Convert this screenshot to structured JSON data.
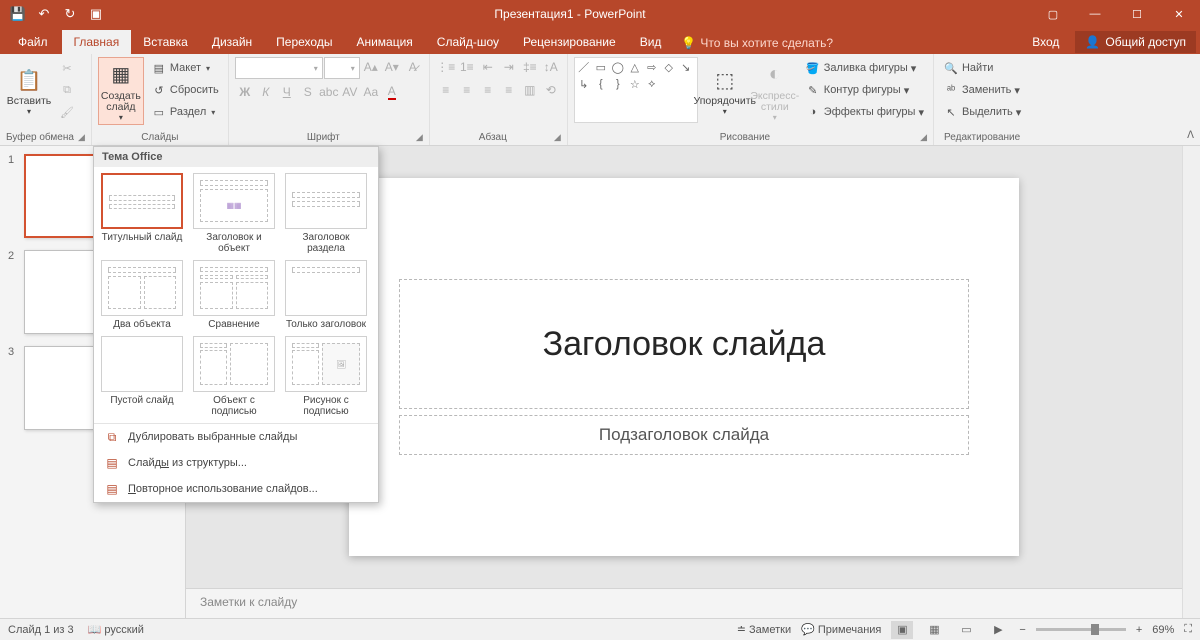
{
  "titlebar": {
    "title": "Презентация1 - PowerPoint"
  },
  "tabs": {
    "file": "Файл",
    "items": [
      "Главная",
      "Вставка",
      "Дизайн",
      "Переходы",
      "Анимация",
      "Слайд-шоу",
      "Рецензирование",
      "Вид"
    ],
    "active_index": 0,
    "tell_me": "Что вы хотите сделать?",
    "login": "Вход",
    "share": "Общий доступ"
  },
  "ribbon": {
    "clipboard": {
      "label": "Буфер обмена",
      "paste": "Вставить"
    },
    "slides": {
      "label": "Слайды",
      "new_slide": "Создать\nслайд",
      "layout": "Макет",
      "reset": "Сбросить",
      "section": "Раздел"
    },
    "font": {
      "label": "Шрифт"
    },
    "paragraph": {
      "label": "Абзац"
    },
    "drawing": {
      "label": "Рисование",
      "arrange": "Упорядочить",
      "quick_styles": "Экспресс-\nстили",
      "shape_fill": "Заливка фигуры",
      "shape_outline": "Контур фигуры",
      "shape_effects": "Эффекты фигуры"
    },
    "editing": {
      "label": "Редактирование",
      "find": "Найти",
      "replace": "Заменить",
      "select": "Выделить"
    }
  },
  "layout_popup": {
    "header": "Тема Office",
    "layouts": [
      "Титульный слайд",
      "Заголовок и объект",
      "Заголовок раздела",
      "Два объекта",
      "Сравнение",
      "Только заголовок",
      "Пустой слайд",
      "Объект с подписью",
      "Рисунок с подписью"
    ],
    "cmd_duplicate": "Дублировать выбранные слайды",
    "cmd_outline": "Слайды из структуры...",
    "cmd_reuse": "Повторное использование слайдов..."
  },
  "slide": {
    "title_placeholder": "Заголовок слайда",
    "subtitle_placeholder": "Подзаголовок слайда"
  },
  "notes": {
    "placeholder": "Заметки к слайду"
  },
  "status": {
    "slide_of": "Слайд 1 из 3",
    "language": "русский",
    "notes": "Заметки",
    "comments": "Примечания",
    "zoom": "69%"
  },
  "thumbnails": {
    "count": 3,
    "active": 1
  }
}
